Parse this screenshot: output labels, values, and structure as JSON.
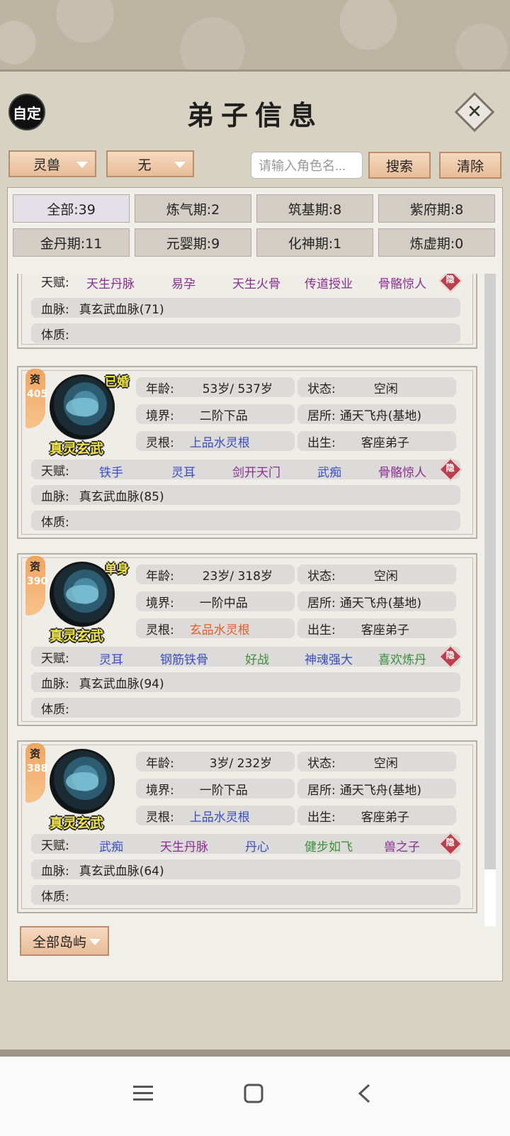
{
  "header": {
    "title": "弟子信息",
    "auto_label": "自定",
    "close_icon": "close-icon"
  },
  "toolbar": {
    "type_select": "灵兽",
    "sub_select": "无",
    "search_placeholder": "请输入角色名...",
    "search_label": "搜索",
    "clear_label": "清除"
  },
  "filters": [
    {
      "label": "全部:39",
      "active": true
    },
    {
      "label": "炼气期:2"
    },
    {
      "label": "筑基期:8"
    },
    {
      "label": "紫府期:8"
    },
    {
      "label": "金丹期:11"
    },
    {
      "label": "元婴期:9"
    },
    {
      "label": "化神期:1"
    },
    {
      "label": "炼虚期:0"
    }
  ],
  "labels": {
    "talent": "天赋:",
    "bloodline": "血脉:",
    "physique": "体质:",
    "age": "年龄:",
    "realm": "境界:",
    "root": "灵根:",
    "status": "状态:",
    "residence": "居所:",
    "birth": "出生:",
    "zi": "资",
    "hide": "隐"
  },
  "partial_card": {
    "talents": [
      {
        "text": "天生丹脉",
        "color": "#8a2f8f"
      },
      {
        "text": "易孕",
        "color": "#8a2f8f"
      },
      {
        "text": "天生火骨",
        "color": "#8a2f8f"
      },
      {
        "text": "传道授业",
        "color": "#8a2f8f"
      },
      {
        "text": "骨骼惊人",
        "color": "#8a2f8f"
      }
    ],
    "bloodline": "真玄武血脉(71)",
    "physique": ""
  },
  "cards": [
    {
      "zi_value": "405",
      "name": "真灵玄武",
      "marital": "已婚",
      "age": "53岁/ 537岁",
      "status": "空闲",
      "realm": "二阶下品",
      "residence": "通天飞舟(基地)",
      "root": "上品水灵根",
      "root_color": "#3a4fbf",
      "birth": "客座弟子",
      "talents": [
        {
          "text": "铁手",
          "color": "#3a4fbf"
        },
        {
          "text": "灵耳",
          "color": "#3a4fbf"
        },
        {
          "text": "剑开天门",
          "color": "#8a2f8f"
        },
        {
          "text": "武痴",
          "color": "#3a4fbf"
        },
        {
          "text": "骨骼惊人",
          "color": "#8a2f8f"
        }
      ],
      "bloodline": "真玄武血脉(85)",
      "physique": ""
    },
    {
      "zi_value": "390",
      "name": "真灵玄武",
      "marital": "单身",
      "age": "23岁/ 318岁",
      "status": "空闲",
      "realm": "一阶中品",
      "residence": "通天飞舟(基地)",
      "root": "玄品水灵根",
      "root_color": "#e0602c",
      "birth": "客座弟子",
      "talents": [
        {
          "text": "灵耳",
          "color": "#3a4fbf"
        },
        {
          "text": "钢筋铁骨",
          "color": "#3a4fbf"
        },
        {
          "text": "好战",
          "color": "#3d8f3a"
        },
        {
          "text": "神魂强大",
          "color": "#3a4fbf"
        },
        {
          "text": "喜欢炼丹",
          "color": "#3d8f3a"
        }
      ],
      "bloodline": "真玄武血脉(94)",
      "physique": ""
    },
    {
      "zi_value": "388",
      "name": "真灵玄武",
      "marital": "",
      "age": "3岁/ 232岁",
      "status": "空闲",
      "realm": "一阶下品",
      "residence": "通天飞舟(基地)",
      "root": "上品水灵根",
      "root_color": "#3a4fbf",
      "birth": "客座弟子",
      "talents": [
        {
          "text": "武痴",
          "color": "#3a4fbf"
        },
        {
          "text": "天生丹脉",
          "color": "#8a2f8f"
        },
        {
          "text": "丹心",
          "color": "#3a4fbf"
        },
        {
          "text": "健步如飞",
          "color": "#3d8f3a"
        },
        {
          "text": "兽之子",
          "color": "#8a2f8f"
        }
      ],
      "bloodline": "真玄武血脉(64)",
      "physique": ""
    }
  ],
  "footer": {
    "island_select": "全部岛屿"
  },
  "nav": {
    "menu_icon": "menu-icon",
    "home_icon": "home-icon",
    "back_icon": "back-icon"
  }
}
